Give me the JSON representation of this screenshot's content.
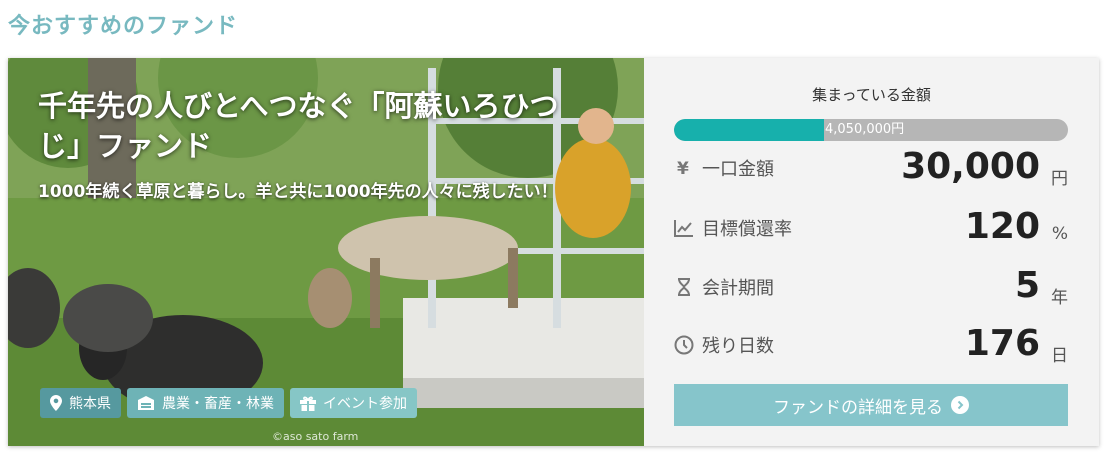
{
  "section": {
    "title": "今おすすめのファンド"
  },
  "fund": {
    "title": "千年先の人びとへつなぐ「阿蘇いろひつじ」ファンド",
    "subtitle": "1000年続く草原と暮らし。羊と共に1000年先の人々に残したい！",
    "credit": "©aso sato farm",
    "tags": [
      {
        "label": "熊本県",
        "icon": "map-pin-icon"
      },
      {
        "label": "農業・畜産・林業",
        "icon": "barn-icon"
      },
      {
        "label": "イベント参加",
        "icon": "gift-icon"
      }
    ]
  },
  "info": {
    "raised_label": "集まっている金額",
    "raised_amount": "4,050,000円",
    "progress_fraction": 0.38,
    "rows": [
      {
        "icon": "yen-icon",
        "label": "一口金額",
        "value": "30,000",
        "unit": "円"
      },
      {
        "icon": "chart-icon",
        "label": "目標償還率",
        "value": "120",
        "unit": "%"
      },
      {
        "icon": "hourglass-icon",
        "label": "会計期間",
        "value": "5",
        "unit": "年"
      },
      {
        "icon": "clock-icon",
        "label": "残り日数",
        "value": "176",
        "unit": "日"
      }
    ],
    "button_label": "ファンドの詳細を見る"
  },
  "colors": {
    "section_title": "#78b9c0",
    "progress_fill": "#17b0ac",
    "progress_track": "#b6b6b6",
    "button": "#86c5cb"
  }
}
